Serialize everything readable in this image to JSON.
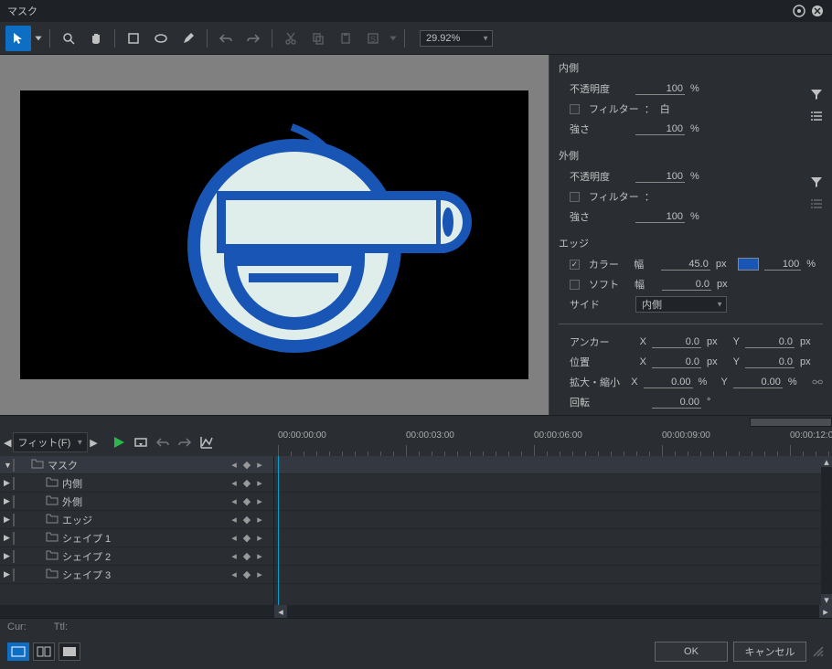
{
  "window": {
    "title": "マスク"
  },
  "toolbar": {
    "zoom": "29.92%"
  },
  "props": {
    "inner": {
      "title": "内側",
      "opacity_label": "不透明度",
      "opacity": "100",
      "opacity_unit": "%",
      "filter_label": "フィルター",
      "filter_sep": "：",
      "filter_value": "白",
      "strength_label": "強さ",
      "strength": "100",
      "strength_unit": "%"
    },
    "outer": {
      "title": "外側",
      "opacity_label": "不透明度",
      "opacity": "100",
      "opacity_unit": "%",
      "filter_label": "フィルター",
      "filter_sep": "：",
      "strength_label": "強さ",
      "strength": "100",
      "strength_unit": "%"
    },
    "edge": {
      "title": "エッジ",
      "color_label": "カラー",
      "width_label": "幅",
      "width": "45.0",
      "width_unit": "px",
      "color_pct": "100",
      "color_pct_unit": "%",
      "soft_label": "ソフト",
      "soft_width_label": "幅",
      "soft_width": "0.0",
      "soft_width_unit": "px",
      "side_label": "サイド",
      "side_value": "内側"
    },
    "transform": {
      "anchor_label": "アンカー",
      "anchor_x": "0.0",
      "anchor_y": "0.0",
      "pos_label": "位置",
      "pos_x": "0.0",
      "pos_y": "0.0",
      "scale_label": "拡大・縮小",
      "scale_x": "0.00",
      "scale_y": "0.00",
      "rot_label": "回転",
      "rot": "0.00",
      "x_label": "X",
      "y_label": "Y",
      "px": "px",
      "pct": "%",
      "deg": "°"
    }
  },
  "timeline": {
    "fit_label": "フィット(F)",
    "timecodes": [
      "00:00:00:00",
      "00:00:03:00",
      "00:00:06:00",
      "00:00:09:00",
      "00:00:12:00"
    ],
    "tracks": [
      {
        "name": "マスク",
        "root": true
      },
      {
        "name": "内側"
      },
      {
        "name": "外側"
      },
      {
        "name": "エッジ"
      },
      {
        "name": "シェイプ 1"
      },
      {
        "name": "シェイプ 2"
      },
      {
        "name": "シェイプ 3"
      }
    ]
  },
  "status": {
    "cur": "Cur:",
    "ttl": "Ttl:"
  },
  "footer": {
    "ok": "OK",
    "cancel": "キャンセル"
  }
}
